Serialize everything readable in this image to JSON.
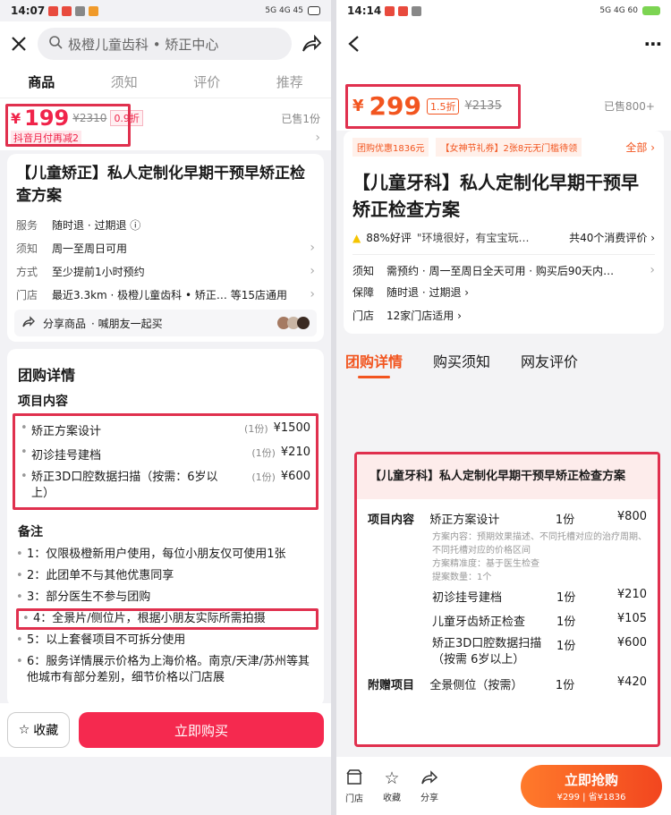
{
  "left": {
    "status": {
      "time": "14:07",
      "right": "5G 4G 45"
    },
    "search_text": "极橙儿童齿科 • 矫正中心",
    "tabs": [
      "商品",
      "须知",
      "评价",
      "推荐"
    ],
    "price": {
      "currency": "¥",
      "value": "199",
      "original": "¥2310",
      "discount": "0.9折",
      "sold": "已售1份",
      "promo": "抖音月付再减2"
    },
    "title": "【儿童矫正】私人定制化早期干预早矫正检查方案",
    "info": [
      {
        "label": "服务",
        "value": "随时退 · 过期退 ⓘ"
      },
      {
        "label": "须知",
        "value": "周一至周日可用"
      },
      {
        "label": "方式",
        "value": "至少提前1小时预约"
      },
      {
        "label": "门店",
        "value": "最近3.3km · 极橙儿童齿科 • 矫正… 等15店通用"
      }
    ],
    "share": {
      "share_label": "分享商品",
      "invite": "· 喊朋友一起买"
    },
    "detail": {
      "title": "团购详情",
      "section": "项目内容",
      "items": [
        {
          "name": "矫正方案设计",
          "qty": "(1份)",
          "price": "¥1500"
        },
        {
          "name": "初诊挂号建档",
          "qty": "(1份)",
          "price": "¥210"
        },
        {
          "name": "矫正3D口腔数据扫描（按需：6岁以上）",
          "qty": "(1份)",
          "price": "¥600"
        }
      ],
      "notes_title": "备注",
      "notes": [
        "1：仅限极橙新用户使用，每位小朋友仅可使用1张",
        "2：此团单不与其他优惠同享",
        "3：部分医生不参与团购",
        "4：全景片/侧位片，根据小朋友实际所需拍摄",
        "5：以上套餐项目不可拆分使用",
        "6：服务详情展示价格为上海价格。南京/天津/苏州等其他城市有部分差别，细节价格以门店展"
      ]
    },
    "bottom": {
      "fav": "收藏",
      "buy": "立即购买"
    }
  },
  "right": {
    "status": {
      "time": "14:14",
      "right": "5G 4G 60"
    },
    "price": {
      "currency": "¥",
      "value": "299",
      "discount": "1.5折",
      "original": "¥2135",
      "sold": "已售800+"
    },
    "coupons": {
      "c1": "团购优惠1836元",
      "c2": "【女神节礼券】2张8元无门槛待领",
      "all": "全部 ›"
    },
    "title": "【儿童牙科】私人定制化早期干预早矫正检查方案",
    "rating": {
      "good": "88%好评",
      "quote": "\"环境很好，有宝宝玩…",
      "count": "共40个消费评价 ›"
    },
    "info": [
      {
        "label": "须知",
        "value": "需预约 · 周一至周日全天可用 · 购买后90天内…"
      },
      {
        "label": "保障",
        "value": "随时退 · 过期退 ›"
      },
      {
        "label": "门店",
        "value": "12家门店适用 ›"
      }
    ],
    "tabs": [
      "团购详情",
      "购买须知",
      "网友评价"
    ],
    "package": {
      "title": "【儿童牙科】私人定制化早期干预早矫正检查方案",
      "section": "项目内容",
      "gift_label": "附赠项目",
      "items": [
        {
          "name": "矫正方案设计",
          "qty": "1份",
          "price": "¥800"
        },
        {
          "name": "初诊挂号建档",
          "qty": "1份",
          "price": "¥210"
        },
        {
          "name": "儿童牙齿矫正检查",
          "qty": "1份",
          "price": "¥105"
        },
        {
          "name": "矫正3D口腔数据扫描（按需 6岁以上）",
          "qty": "1份",
          "price": "¥600"
        }
      ],
      "sub1": "方案内容：预期效果描述、不同托槽对应的治疗周期、不同托槽对应的价格区间",
      "sub2": "方案精准度：基于医生检查",
      "sub3": "提案数量：1个",
      "gift": {
        "name": "全景侧位（按需）",
        "qty": "1份",
        "price": "¥420"
      }
    },
    "bottom": {
      "store": "门店",
      "fav": "收藏",
      "share": "分享",
      "buy": "立即抢购",
      "buy_sub": "¥299 | 省¥1836"
    }
  }
}
